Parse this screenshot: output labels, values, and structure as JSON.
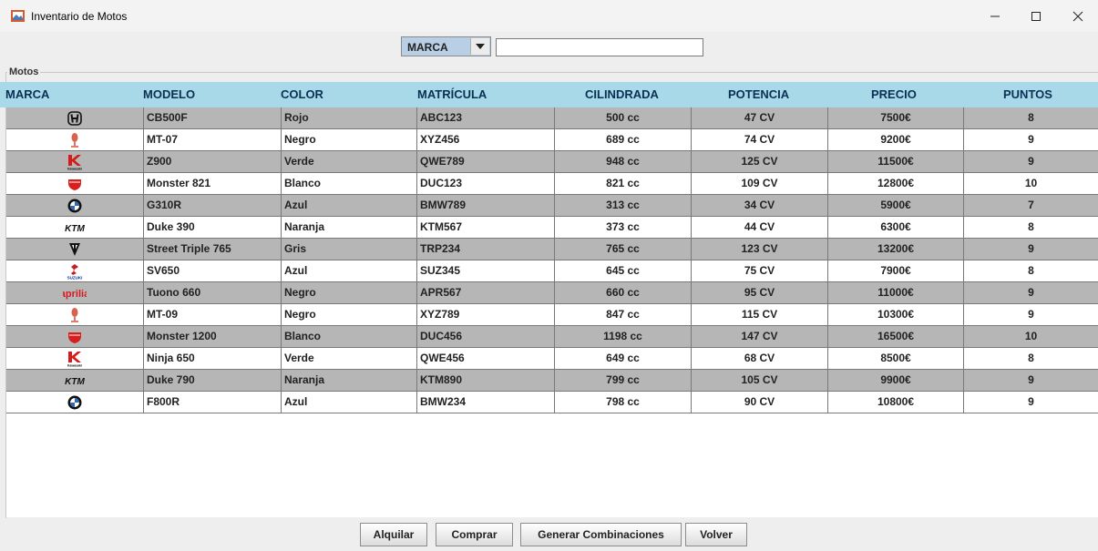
{
  "window": {
    "title": "Inventario de Motos",
    "minimize": "—",
    "maximize": "☐",
    "close": "✕"
  },
  "filter": {
    "selected": "MARCA",
    "search_value": ""
  },
  "group_title": "Motos",
  "columns": [
    "MARCA",
    "MODELO",
    "COLOR",
    "MATRÍCULA",
    "CILINDRADA",
    "POTENCIA",
    "PRECIO",
    "PUNTOS"
  ],
  "rows": [
    {
      "brand_logo": "honda-logo",
      "modelo": "CB500F",
      "color": "Rojo",
      "matricula": "ABC123",
      "cilindrada": "500 cc",
      "potencia": "47 CV",
      "precio": "7500€",
      "puntos": "8"
    },
    {
      "brand_logo": "yamaha-logo",
      "modelo": "MT-07",
      "color": "Negro",
      "matricula": "XYZ456",
      "cilindrada": "689 cc",
      "potencia": "74 CV",
      "precio": "9200€",
      "puntos": "9"
    },
    {
      "brand_logo": "kawasaki-logo",
      "modelo": "Z900",
      "color": "Verde",
      "matricula": "QWE789",
      "cilindrada": "948 cc",
      "potencia": "125 CV",
      "precio": "11500€",
      "puntos": "9"
    },
    {
      "brand_logo": "ducati-logo",
      "modelo": "Monster 821",
      "color": "Blanco",
      "matricula": "DUC123",
      "cilindrada": "821 cc",
      "potencia": "109 CV",
      "precio": "12800€",
      "puntos": "10"
    },
    {
      "brand_logo": "bmw-logo",
      "modelo": "G310R",
      "color": "Azul",
      "matricula": "BMW789",
      "cilindrada": "313 cc",
      "potencia": "34 CV",
      "precio": "5900€",
      "puntos": "7"
    },
    {
      "brand_logo": "ktm-logo",
      "modelo": "Duke 390",
      "color": "Naranja",
      "matricula": "KTM567",
      "cilindrada": "373 cc",
      "potencia": "44 CV",
      "precio": "6300€",
      "puntos": "8"
    },
    {
      "brand_logo": "triumph-logo",
      "modelo": "Street Triple 765",
      "color": "Gris",
      "matricula": "TRP234",
      "cilindrada": "765 cc",
      "potencia": "123 CV",
      "precio": "13200€",
      "puntos": "9"
    },
    {
      "brand_logo": "suzuki-logo",
      "modelo": "SV650",
      "color": "Azul",
      "matricula": "SUZ345",
      "cilindrada": "645 cc",
      "potencia": "75 CV",
      "precio": "7900€",
      "puntos": "8"
    },
    {
      "brand_logo": "aprilia-logo",
      "modelo": "Tuono 660",
      "color": "Negro",
      "matricula": "APR567",
      "cilindrada": "660 cc",
      "potencia": "95 CV",
      "precio": "11000€",
      "puntos": "9"
    },
    {
      "brand_logo": "yamaha-logo",
      "modelo": "MT-09",
      "color": "Negro",
      "matricula": "XYZ789",
      "cilindrada": "847 cc",
      "potencia": "115 CV",
      "precio": "10300€",
      "puntos": "9"
    },
    {
      "brand_logo": "ducati-logo",
      "modelo": "Monster 1200",
      "color": "Blanco",
      "matricula": "DUC456",
      "cilindrada": "1198 cc",
      "potencia": "147 CV",
      "precio": "16500€",
      "puntos": "10"
    },
    {
      "brand_logo": "kawasaki-logo",
      "modelo": "Ninja 650",
      "color": "Verde",
      "matricula": "QWE456",
      "cilindrada": "649 cc",
      "potencia": "68 CV",
      "precio": "8500€",
      "puntos": "8"
    },
    {
      "brand_logo": "ktm-logo",
      "modelo": "Duke 790",
      "color": "Naranja",
      "matricula": "KTM890",
      "cilindrada": "799 cc",
      "potencia": "105 CV",
      "precio": "9900€",
      "puntos": "9"
    },
    {
      "brand_logo": "bmw-logo",
      "modelo": "F800R",
      "color": "Azul",
      "matricula": "BMW234",
      "cilindrada": "798 cc",
      "potencia": "90 CV",
      "precio": "10800€",
      "puntos": "9"
    }
  ],
  "logo_text": {
    "ktm": "KTM",
    "suzuki": "SUZUKI",
    "aprilia": "aprilia",
    "kawasaki": "Kawasaki"
  },
  "buttons": {
    "alquilar": "Alquilar",
    "comprar": "Comprar",
    "generar": "Generar Combinaciones",
    "volver": "Volver"
  },
  "colors": {
    "header": "#a8d9e8",
    "row_alt": "#b6b6b6",
    "combo": "#b8cfe5"
  }
}
